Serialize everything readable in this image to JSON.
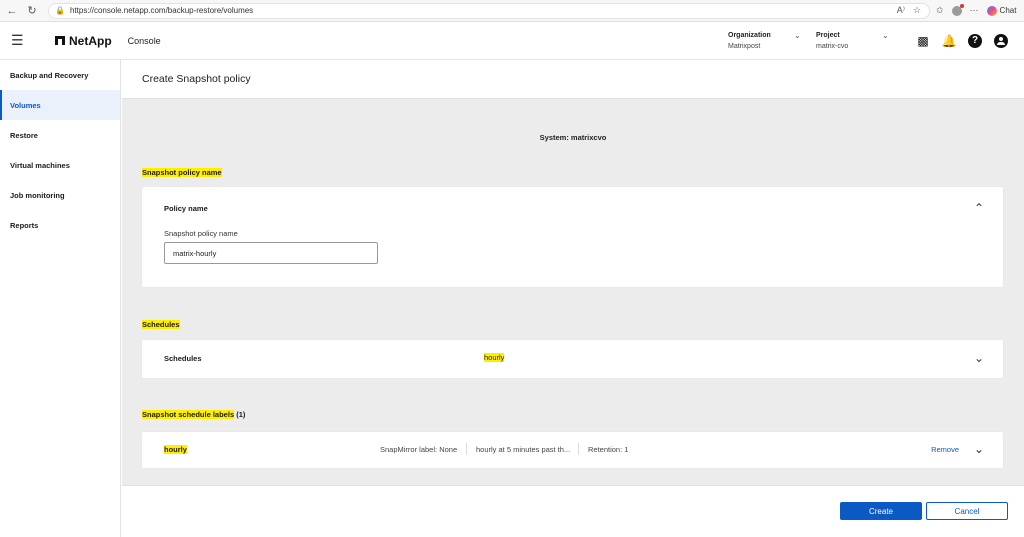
{
  "browser": {
    "url": "https://console.netapp.com/backup-restore/volumes",
    "chat_label": "Chat"
  },
  "header": {
    "brand": "NetApp",
    "app_name": "Console",
    "organization": {
      "title": "Organization",
      "value": "Matrixpost"
    },
    "project": {
      "title": "Project",
      "value": "matrix-cvo"
    }
  },
  "sidebar": {
    "items": [
      {
        "label": "Backup and Recovery"
      },
      {
        "label": "Volumes"
      },
      {
        "label": "Restore"
      },
      {
        "label": "Virtual machines"
      },
      {
        "label": "Job monitoring"
      },
      {
        "label": "Reports"
      }
    ]
  },
  "page": {
    "title": "Create Snapshot policy",
    "system": "System: matrixcvo",
    "policy_section": {
      "title": "Snapshot policy name",
      "card_title": "Policy name",
      "field_label": "Snapshot policy name",
      "field_value": "matrix-hourly"
    },
    "schedules_section": {
      "title": "Schedules",
      "card_title": "Schedules",
      "value": "hourly"
    },
    "labels_section": {
      "title": "Snapshot schedule labels",
      "count": "(1)",
      "rows": [
        {
          "name": "hourly",
          "snapmirror": "SnapMirror label: None",
          "schedule": "hourly at 5 minutes past th...",
          "retention": "Retention: 1",
          "remove": "Remove"
        }
      ]
    },
    "footer": {
      "create": "Create",
      "cancel": "Cancel"
    }
  },
  "colors": {
    "accent": "#0b59c2",
    "highlight": "#ffee00",
    "background": "#ececec"
  }
}
